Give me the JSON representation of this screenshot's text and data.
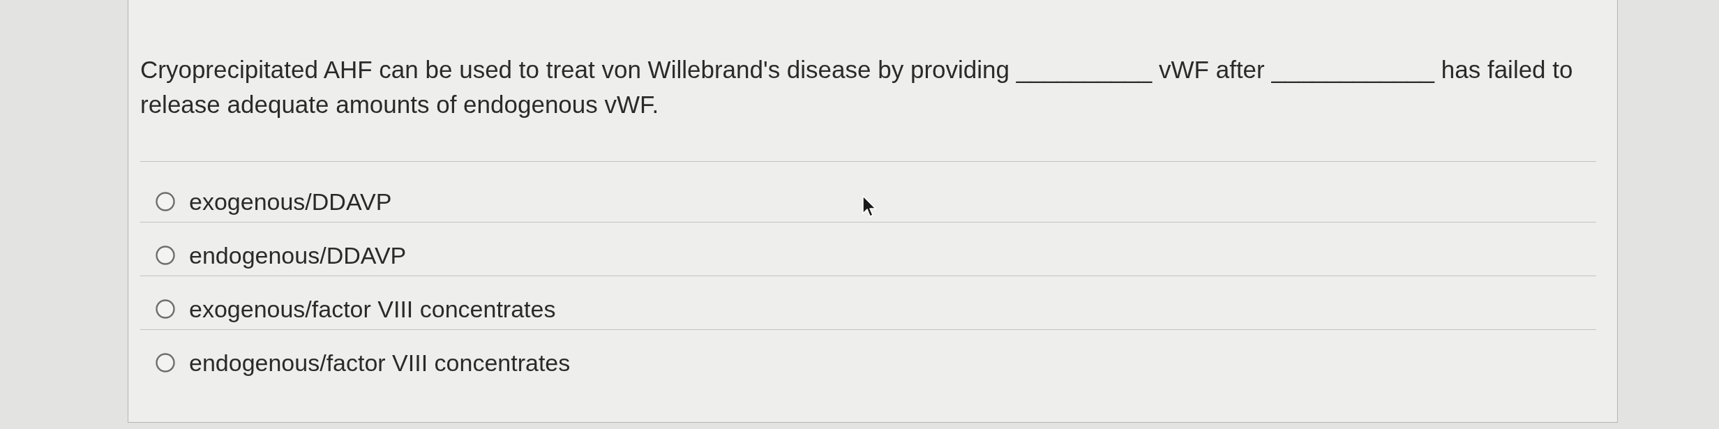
{
  "question": {
    "text": "Cryoprecipitated AHF can be used to treat von Willebrand's disease by providing __________ vWF after ____________ has failed to release adequate amounts of endogenous vWF."
  },
  "options": [
    {
      "label": "exogenous/DDAVP",
      "selected": false
    },
    {
      "label": "endogenous/DDAVP",
      "selected": false
    },
    {
      "label": "exogenous/factor VIII concentrates",
      "selected": false
    },
    {
      "label": "endogenous/factor VIII concentrates",
      "selected": false
    }
  ]
}
